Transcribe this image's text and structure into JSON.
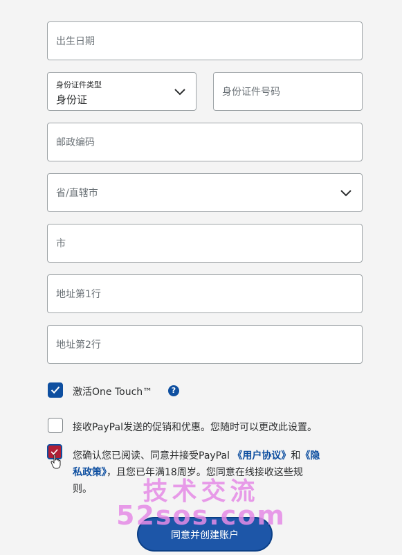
{
  "form": {
    "birthdate_placeholder": "出生日期",
    "id_type_label": "身份证件类型",
    "id_type_value": "身份证",
    "id_number_placeholder": "身份证件号码",
    "postal_placeholder": "邮政编码",
    "province_placeholder": "省/直辖市",
    "city_placeholder": "市",
    "address1_placeholder": "地址第1行",
    "address2_placeholder": "地址第2行"
  },
  "options": {
    "one_touch_label": "激活One Touch™",
    "one_touch_checked": true,
    "help_glyph": "?",
    "promo_label": "接收PayPal发送的促销和优惠。您随时可以更改此设置。",
    "promo_checked": false,
    "agree_checked": true,
    "agree_line1_before": "您确认您已阅读、同意并接受PayPal",
    "agree_link_user": "《用户协议》",
    "agree_line1_mid": "和",
    "agree_link_privacy_1": "《隐",
    "agree_link_privacy_2": "私政策》",
    "agree_line2_after": "，且您已年满18周岁。您同意在线接收这些规",
    "agree_line3": "则。"
  },
  "submit_label": "同意并创建账户",
  "watermark": {
    "line1": "技术交流",
    "line2": "52sos.com"
  },
  "colors": {
    "accent": "#0e4fa0",
    "button": "#1d56a8",
    "watermark": "#e58be6"
  }
}
